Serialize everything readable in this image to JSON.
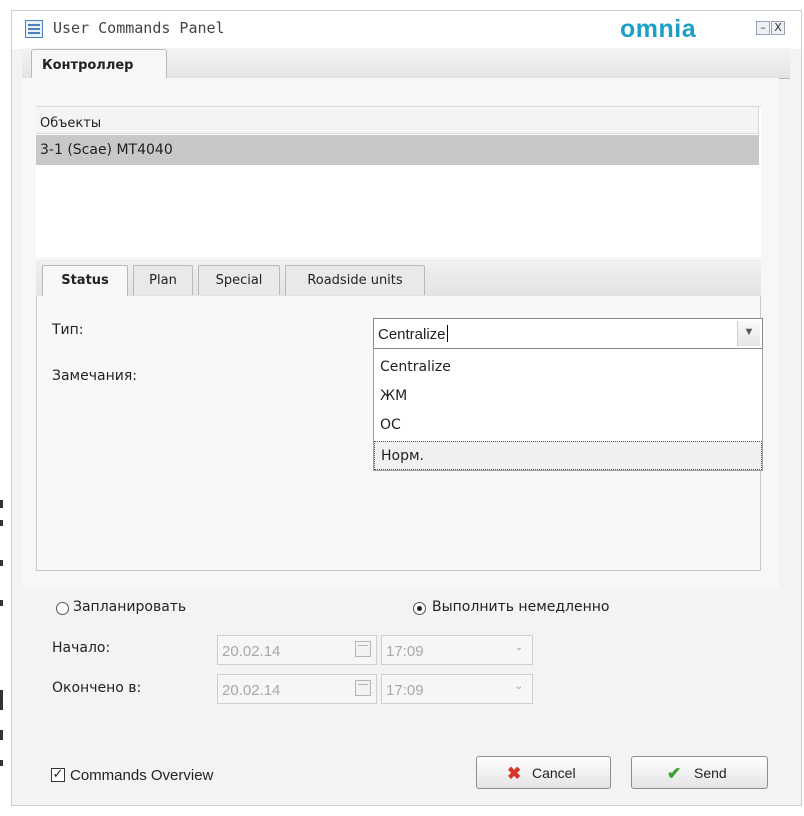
{
  "window": {
    "title": "User Commands Panel",
    "logo": "omnia",
    "minimize_glyph": "–",
    "close_glyph": "X"
  },
  "main_tab": {
    "label": "Контроллер"
  },
  "objects": {
    "header": "Объекты",
    "rows": [
      "3-1 (Scae) MT4040"
    ]
  },
  "subtabs": [
    {
      "label": "Status",
      "active": true
    },
    {
      "label": "Plan",
      "active": false
    },
    {
      "label": "Special",
      "active": false
    },
    {
      "label": "Roadside units",
      "active": false
    }
  ],
  "status": {
    "type_label": "Тип:",
    "remarks_label": "Замечания:",
    "type_value": "Centralize",
    "type_options": [
      "Centralize",
      "ЖМ",
      "ОС",
      "Норм."
    ],
    "hover_option_index": 3
  },
  "schedule": {
    "schedule_label": "Запланировать",
    "schedule_selected": false,
    "execute_now_label": "Выполнить немедленно",
    "execute_now_selected": true,
    "start_label": "Начало:",
    "start_date": "20.02.14",
    "start_time": "17:09",
    "end_label": "Окончено в:",
    "end_date": "20.02.14",
    "end_time": "17:09"
  },
  "footer": {
    "overview_label": "Commands Overview",
    "overview_checked": true,
    "cancel_label": "Cancel",
    "send_label": "Send"
  },
  "colors": {
    "logo": "#1aa0c8",
    "cancel_icon": "#d9342b",
    "send_icon": "#3aa335",
    "selected_row": "#c8c8c8"
  },
  "icons": {
    "app": "table-icon",
    "cancel": "x-mark-icon",
    "send": "check-mark-icon",
    "calendar": "calendar-icon",
    "dropdown": "chevron-down-icon"
  }
}
